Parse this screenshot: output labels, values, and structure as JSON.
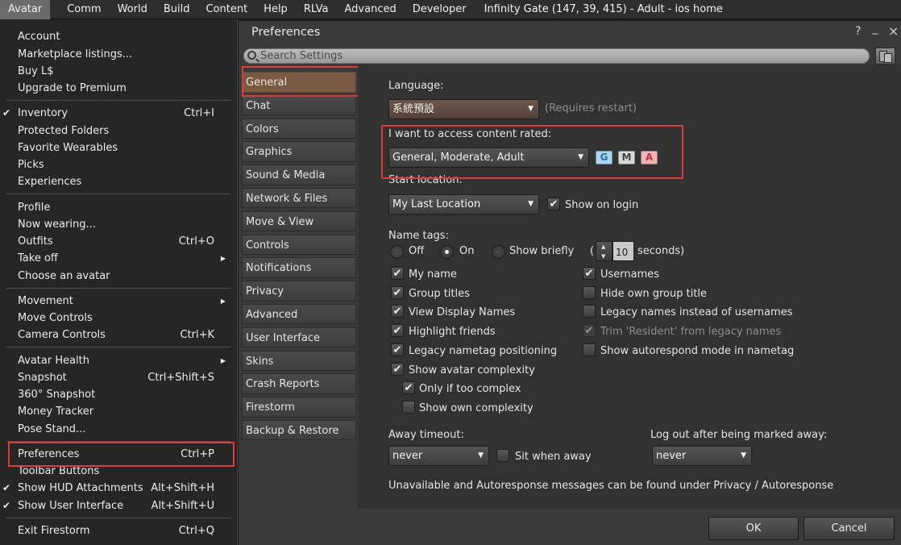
{
  "menubar": {
    "items": [
      "Avatar",
      "Comm",
      "World",
      "Build",
      "Content",
      "Help",
      "RLVa",
      "Advanced",
      "Developer"
    ],
    "title": "Infinity Gate (147, 39, 415) - Adult - ios home"
  },
  "avatar_menu": {
    "account": "Account",
    "marketplace": "Marketplace listings...",
    "buy": "Buy L$",
    "upgrade": "Upgrade to Premium",
    "inventory": "Inventory",
    "inventory_sc": "Ctrl+I",
    "protected": "Protected Folders",
    "favorites": "Favorite Wearables",
    "picks": "Picks",
    "experiences": "Experiences",
    "profile": "Profile",
    "now_wearing": "Now wearing...",
    "outfits": "Outfits",
    "outfits_sc": "Ctrl+O",
    "take_off": "Take off",
    "choose": "Choose an avatar",
    "movement": "Movement",
    "move_controls": "Move Controls",
    "camera": "Camera Controls",
    "camera_sc": "Ctrl+K",
    "health": "Avatar Health",
    "snapshot": "Snapshot",
    "snapshot_sc": "Ctrl+Shift+S",
    "snap360": "360° Snapshot",
    "money": "Money Tracker",
    "pose": "Pose Stand...",
    "preferences": "Preferences",
    "preferences_sc": "Ctrl+P",
    "toolbar": "Toolbar Buttons",
    "hud": "Show HUD Attachments",
    "hud_sc": "Alt+Shift+H",
    "ui": "Show User Interface",
    "ui_sc": "Alt+Shift+U",
    "exit": "Exit Firestorm",
    "exit_sc": "Ctrl+Q"
  },
  "prefs": {
    "title": "Preferences",
    "help": "?",
    "minimize": "_",
    "close": "×",
    "search_placeholder": "Search Settings",
    "tabs": [
      "General",
      "Chat",
      "Colors",
      "Graphics",
      "Sound & Media",
      "Network & Files",
      "Move & View",
      "Controls",
      "Notifications",
      "Privacy",
      "Advanced",
      "User Interface",
      "Skins",
      "Crash Reports",
      "Firestorm",
      "Backup & Restore"
    ],
    "language_label": "Language:",
    "language_value": "系統預設",
    "restart_note": "(Requires restart)",
    "rated_label": "I want to access content rated:",
    "rated_value": "General, Moderate, Adult",
    "rating_g": "G",
    "rating_m": "M",
    "rating_a": "A",
    "start_label": "Start location:",
    "start_value": "My Last Location",
    "show_login": "Show on login",
    "name_tags_label": "Name tags:",
    "nt_off": "Off",
    "nt_on": "On",
    "nt_brief": "Show briefly",
    "paren_open": "(",
    "seconds_value": "10",
    "seconds_label": "seconds)",
    "cb_my_name": "My name",
    "cb_usernames": "Usernames",
    "cb_group_titles": "Group titles",
    "cb_hide_group": "Hide own group title",
    "cb_display_names": "View Display Names",
    "cb_legacy_names": "Legacy names instead of usernames",
    "cb_highlight": "Highlight friends",
    "cb_trim": "Trim 'Resident' from legacy names",
    "cb_legacy_pos": "Legacy nametag positioning",
    "cb_autorespond": "Show autorespond mode in nametag",
    "cb_complexity": "Show avatar complexity",
    "cb_too_complex": "Only if too complex",
    "cb_own_complexity": "Show own complexity",
    "away_label": "Away timeout:",
    "away_value": "never",
    "sit_away": "Sit when away",
    "logout_label": "Log out after being marked away:",
    "logout_value": "never",
    "note": "Unavailable and Autoresponse messages can be found under Privacy / Autoresponse",
    "ok": "OK",
    "cancel": "Cancel"
  },
  "colors": {
    "highlight_red": "#e03a3a",
    "tab_selected": "#7b5a44",
    "rating_g": "#a9d7f2",
    "rating_m": "#d9d9d9",
    "rating_a": "#f2b3b3"
  }
}
